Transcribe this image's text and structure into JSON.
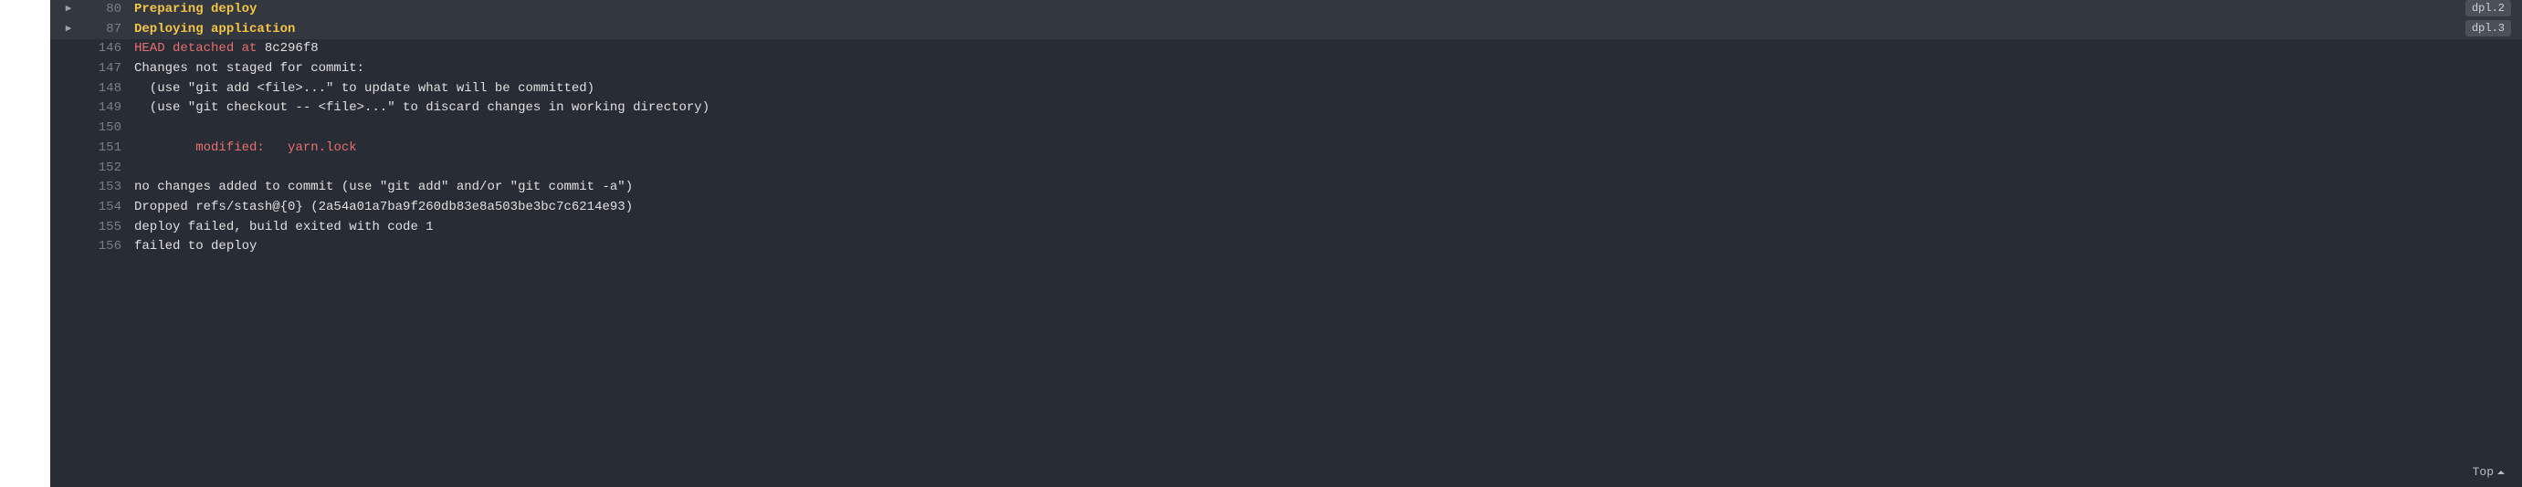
{
  "groups": [
    {
      "lineno": "80",
      "label": "Preparing deploy",
      "badge": "dpl.2"
    },
    {
      "lineno": "87",
      "label": "Deploying application",
      "badge": "dpl.3"
    }
  ],
  "lines": {
    "l146_no": "146",
    "l146_prefix": "HEAD detached at ",
    "l146_hash": "8c296f8",
    "l147_no": "147",
    "l147": "Changes not staged for commit:",
    "l148_no": "148",
    "l148": "  (use \"git add <file>...\" to update what will be committed)",
    "l149_no": "149",
    "l149": "  (use \"git checkout -- <file>...\" to discard changes in working directory)",
    "l150_no": "150",
    "l150": "",
    "l151_no": "151",
    "l151_indent": "        ",
    "l151_mod": "modified:   ",
    "l151_file": "yarn.lock",
    "l152_no": "152",
    "l152": "",
    "l153_no": "153",
    "l153": "no changes added to commit (use \"git add\" and/or \"git commit -a\")",
    "l154_no": "154",
    "l154": "Dropped refs/stash@{0} (2a54a01a7ba9f260db83e8a503be3bc7c6214e93)",
    "l155_no": "155",
    "l155": "deploy failed, build exited with code 1",
    "l156_no": "156",
    "l156": "failed to deploy"
  },
  "top_label": "Top"
}
